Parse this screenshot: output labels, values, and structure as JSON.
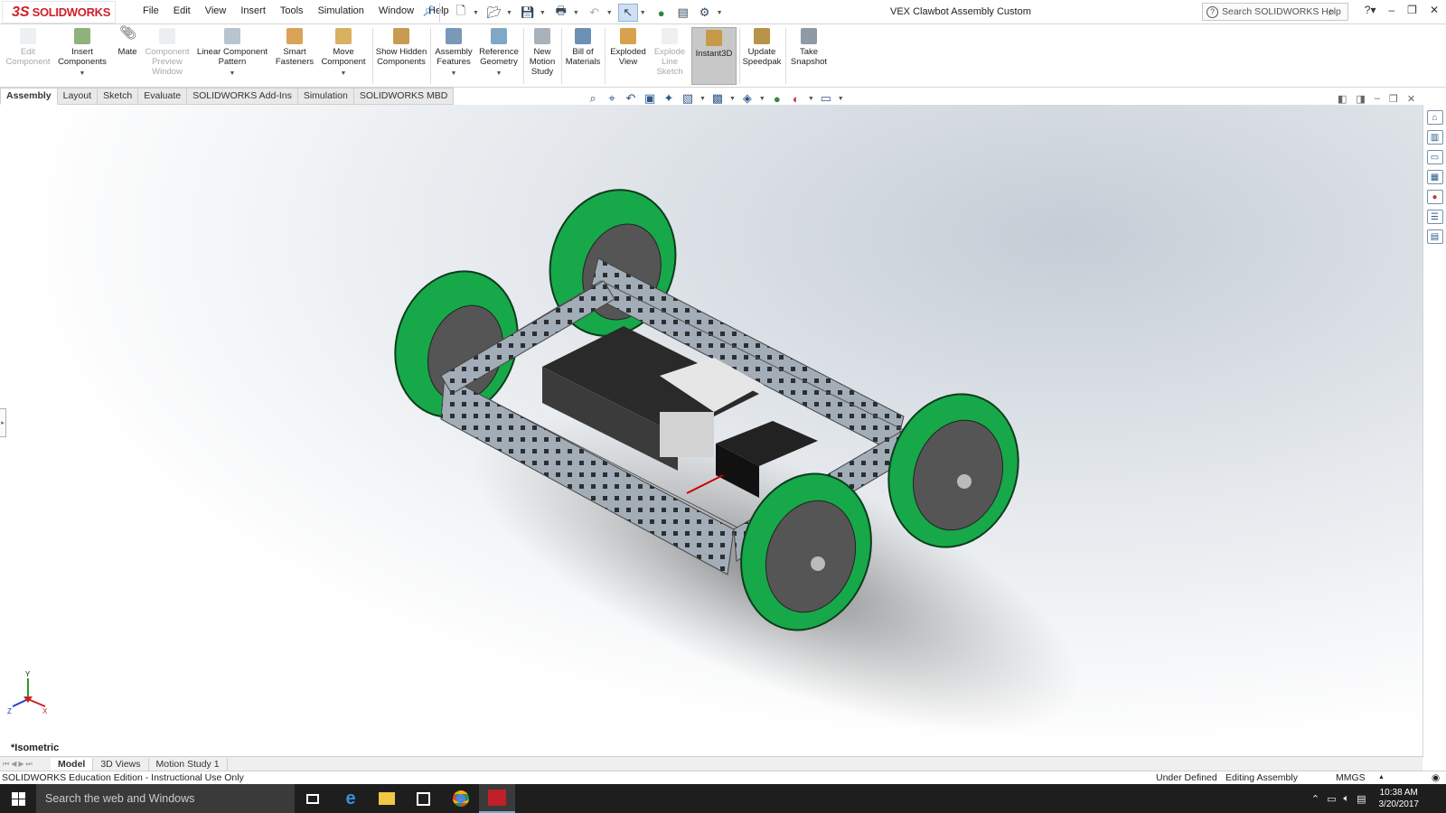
{
  "app": {
    "logo_ds": "3S",
    "logo_text": "SOLIDWORKS",
    "document_title": "VEX Clawbot Assembly Custom"
  },
  "menu": [
    "File",
    "Edit",
    "View",
    "Insert",
    "Tools",
    "Simulation",
    "Window",
    "Help"
  ],
  "help_search": {
    "placeholder": "Search SOLIDWORKS Help",
    "help_symbol": "?"
  },
  "command_manager": {
    "edit_component": "Edit Component",
    "insert_components": "Insert Components",
    "mate": "Mate",
    "component_preview_window": "Component Preview Window",
    "linear_component_pattern": "Linear Component Pattern",
    "smart_fasteners": "Smart Fasteners",
    "move_component": "Move Component",
    "show_hidden_components": "Show Hidden Components",
    "assembly_features": "Assembly Features",
    "reference_geometry": "Reference Geometry",
    "new_motion_study": "New Motion Study",
    "bill_of_materials": "Bill of Materials",
    "exploded_view": "Exploded View",
    "explode_line_sketch": "Explode Line Sketch",
    "instant3d": "Instant3D",
    "update_speedpak": "Update Speedpak",
    "take_snapshot": "Take Snapshot"
  },
  "tabs": [
    "Assembly",
    "Layout",
    "Sketch",
    "Evaluate",
    "SOLIDWORKS Add-Ins",
    "Simulation",
    "SOLIDWORKS MBD"
  ],
  "active_tab": "Assembly",
  "viewport": {
    "view_orientation": "*Isometric",
    "triad_x": "X",
    "triad_y": "Y",
    "triad_z": "Z"
  },
  "bottom_tabs": [
    "Model",
    "3D Views",
    "Motion Study 1"
  ],
  "status": {
    "edition": "SOLIDWORKS Education Edition - Instructional Use Only",
    "definition": "Under Defined",
    "mode": "Editing Assembly",
    "units": "MMGS"
  },
  "taskbar": {
    "search_placeholder": "Search the web and Windows",
    "time": "10:38 AM",
    "date": "3/20/2017"
  },
  "colors": {
    "brand_red": "#d0202a",
    "wheel_green": "#17a84a",
    "chassis_metal": "#9aa4ae"
  }
}
